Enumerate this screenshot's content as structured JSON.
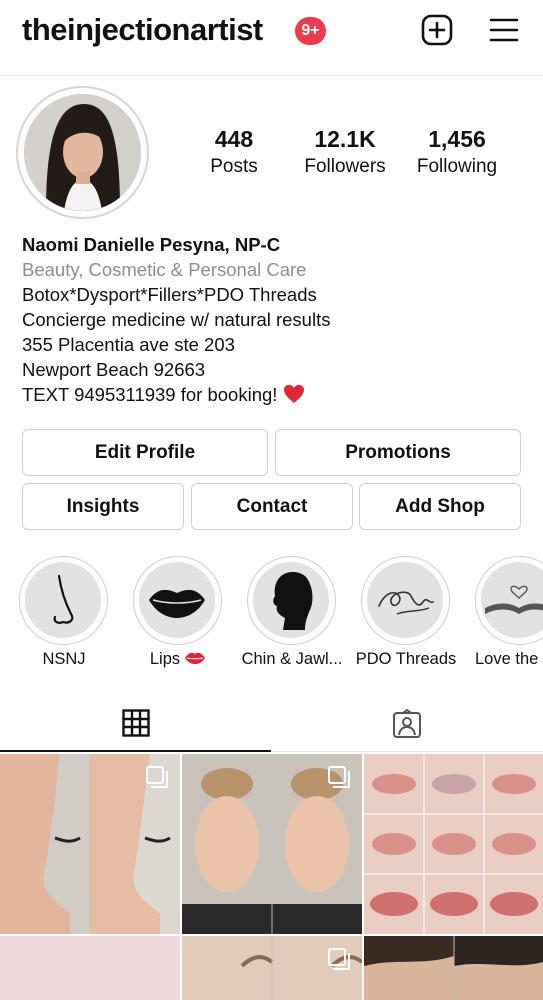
{
  "header": {
    "username": "theinjectionartist",
    "notification_badge": "9+",
    "badge_color": "#ee3a4f",
    "icons": [
      "plus-square-icon",
      "hamburger-menu-icon"
    ]
  },
  "profile": {
    "stats": [
      {
        "value": "448",
        "label": "Posts"
      },
      {
        "value": "12.1K",
        "label": "Followers"
      },
      {
        "value": "1,456",
        "label": "Following"
      }
    ],
    "name": "Naomi Danielle Pesyna, NP-C",
    "category": "Beauty, Cosmetic & Personal Care",
    "bio_lines": [
      "Botox*Dysport*Fillers*PDO Threads",
      "Concierge medicine w/ natural results",
      "355 Placentia ave ste 203",
      "Newport Beach 92663",
      "TEXT 9495311939 for booking!"
    ],
    "bio_emoji": "heart-emoji"
  },
  "buttons": {
    "edit_profile": "Edit Profile",
    "promotions": "Promotions",
    "insights": "Insights",
    "contact": "Contact",
    "add_shop": "Add Shop"
  },
  "highlights": [
    {
      "label": "NSNJ",
      "icon": "nose-icon"
    },
    {
      "label": "Lips",
      "icon": "lips-icon"
    },
    {
      "label": "Chin & Jawl...",
      "icon": "profile-silhouette-icon"
    },
    {
      "label": "PDO Threads",
      "icon": "thread-icon"
    },
    {
      "label": "Love the",
      "icon": "book-heart-icon"
    }
  ],
  "tabs": [
    {
      "name": "grid",
      "icon": "grid-icon",
      "active": true
    },
    {
      "name": "tagged",
      "icon": "tagged-person-icon",
      "active": false
    }
  ],
  "posts": [
    {
      "subject": "nose profile before and after",
      "multi": true
    },
    {
      "subject": "face before and after",
      "multi": true
    },
    {
      "subject": "lips grid",
      "multi": false
    },
    {
      "subject": "pink image",
      "multi": false
    },
    {
      "subject": "brows",
      "multi": true
    },
    {
      "subject": "hairline",
      "multi": false
    }
  ]
}
